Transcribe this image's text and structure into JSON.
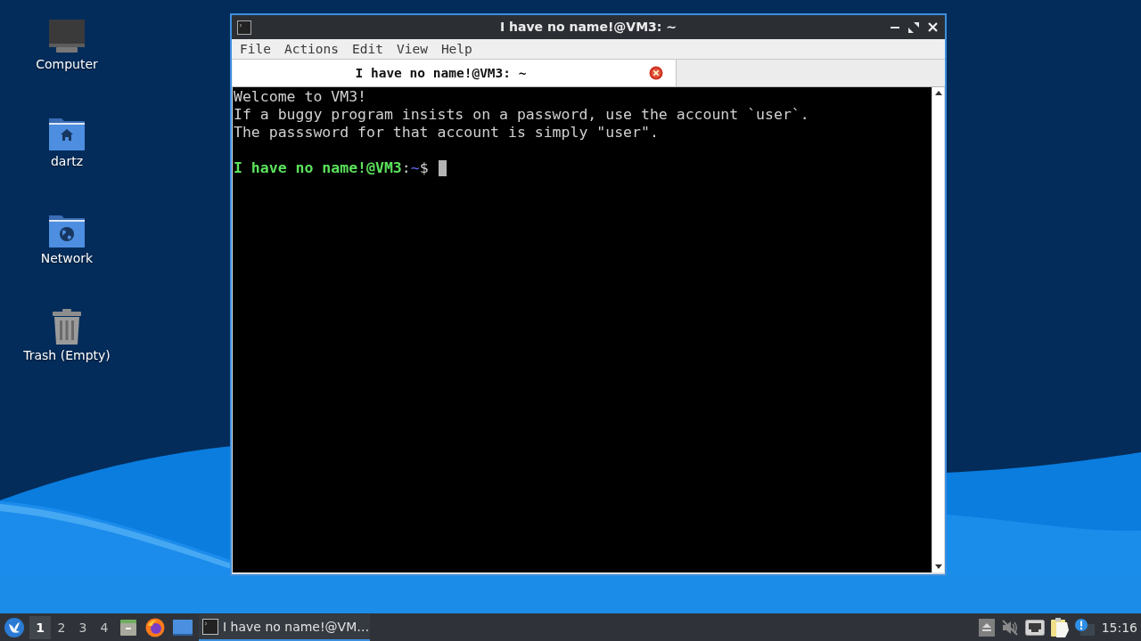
{
  "desktop_icons": [
    {
      "label": "Computer",
      "kind": "computer"
    },
    {
      "label": "dartz",
      "kind": "home"
    },
    {
      "label": "Network",
      "kind": "network"
    },
    {
      "label": "Trash (Empty)",
      "kind": "trash"
    }
  ],
  "window": {
    "title": "I have no name!@VM3: ~",
    "menu": [
      "File",
      "Actions",
      "Edit",
      "View",
      "Help"
    ],
    "tabs": [
      {
        "label": "I have no name!@VM3: ~",
        "selected": true
      }
    ],
    "terminal": {
      "lines": [
        "Welcome to VM3!",
        "If a buggy program insists on a password, use the account `user`.",
        "The passsword for that account is simply \"user\"."
      ],
      "prompt": {
        "user_host": "I have no name!@VM3",
        "separator": ":",
        "path": "~",
        "symbol": "$"
      }
    }
  },
  "taskbar": {
    "workspaces": [
      {
        "label": "1",
        "selected": true
      },
      {
        "label": "2",
        "selected": false
      },
      {
        "label": "3",
        "selected": false
      },
      {
        "label": "4",
        "selected": false
      }
    ],
    "tasks": [
      {
        "label": "I have no name!@VM…",
        "selected": true
      }
    ],
    "tray": {
      "volume_muted": true
    },
    "clock": "15:16"
  }
}
